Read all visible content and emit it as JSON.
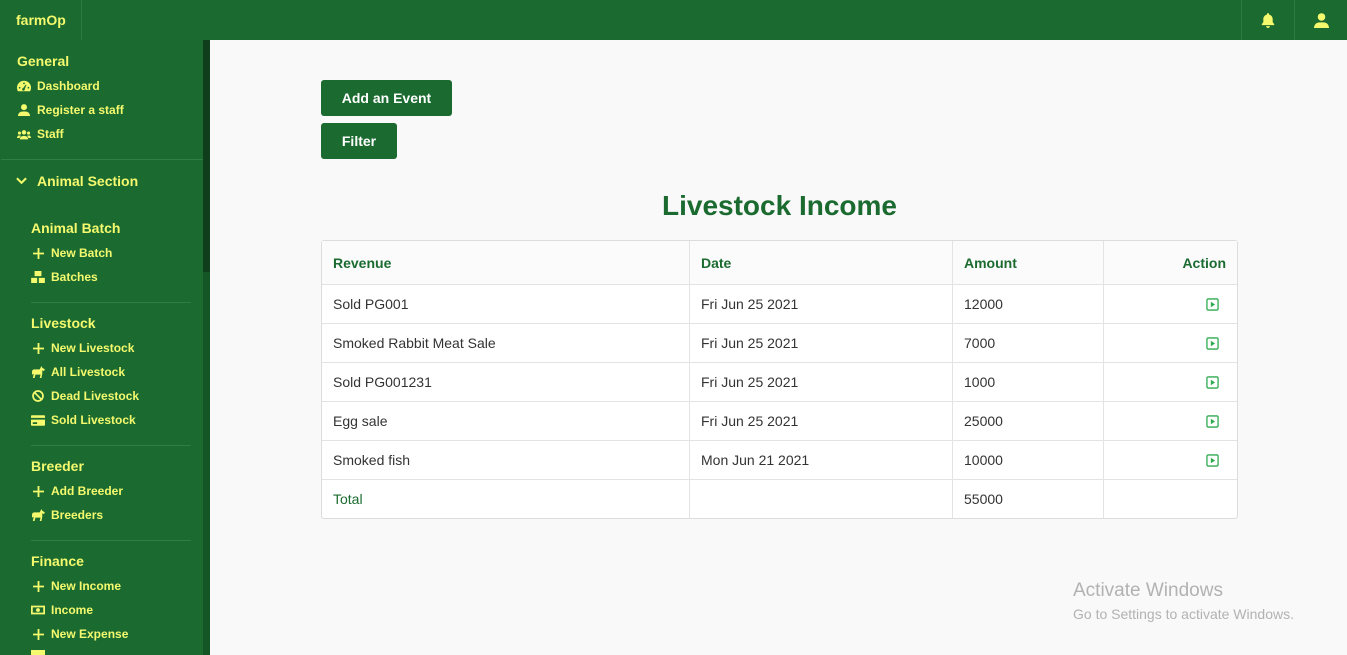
{
  "app": {
    "brand": "farmOp"
  },
  "topbar": {
    "icons": [
      "bell-icon",
      "user-icon"
    ]
  },
  "sidebar": {
    "general": {
      "heading": "General",
      "items": [
        {
          "label": "Dashboard",
          "icon": "tachometer-icon"
        },
        {
          "label": "Register a staff",
          "icon": "user-icon"
        },
        {
          "label": "Staff",
          "icon": "users-icon"
        }
      ]
    },
    "animal_section": {
      "label": "Animal Section",
      "icon": "chevron-down-icon"
    },
    "animal_batch": {
      "heading": "Animal Batch",
      "items": [
        {
          "label": "New Batch",
          "icon": "plus-icon"
        },
        {
          "label": "Batches",
          "icon": "boxes-icon"
        }
      ]
    },
    "livestock": {
      "heading": "Livestock",
      "items": [
        {
          "label": "New Livestock",
          "icon": "plus-icon"
        },
        {
          "label": "All Livestock",
          "icon": "horse-icon"
        },
        {
          "label": "Dead Livestock",
          "icon": "ban-icon"
        },
        {
          "label": "Sold Livestock",
          "icon": "credit-card-icon"
        }
      ]
    },
    "breeder": {
      "heading": "Breeder",
      "items": [
        {
          "label": "Add Breeder",
          "icon": "plus-icon"
        },
        {
          "label": "Breeders",
          "icon": "horse-icon"
        }
      ]
    },
    "finance": {
      "heading": "Finance",
      "items": [
        {
          "label": "New Income",
          "icon": "plus-icon"
        },
        {
          "label": "Income",
          "icon": "money-icon"
        },
        {
          "label": "New Expense",
          "icon": "plus-icon"
        }
      ]
    }
  },
  "main": {
    "add_event_label": "Add an Event",
    "filter_label": "Filter",
    "title": "Livestock Income",
    "table": {
      "headers": [
        "Revenue",
        "Date",
        "Amount",
        "Action"
      ],
      "rows": [
        {
          "revenue": "Sold PG001",
          "date": "Fri Jun 25 2021",
          "amount": "12000"
        },
        {
          "revenue": "Smoked Rabbit Meat Sale",
          "date": "Fri Jun 25 2021",
          "amount": "7000"
        },
        {
          "revenue": "Sold PG001231",
          "date": "Fri Jun 25 2021",
          "amount": "1000"
        },
        {
          "revenue": "Egg sale",
          "date": "Fri Jun 25 2021",
          "amount": "25000"
        },
        {
          "revenue": "Smoked fish",
          "date": "Mon Jun 21 2021",
          "amount": "10000"
        }
      ],
      "total_label": "Total",
      "total_amount": "55000"
    }
  },
  "watermark": {
    "line1": "Activate Windows",
    "line2": "Go to Settings to activate Windows."
  },
  "colors": {
    "primary": "#1b6b30",
    "accent": "#f4f96e",
    "action": "#2eaa4f"
  }
}
